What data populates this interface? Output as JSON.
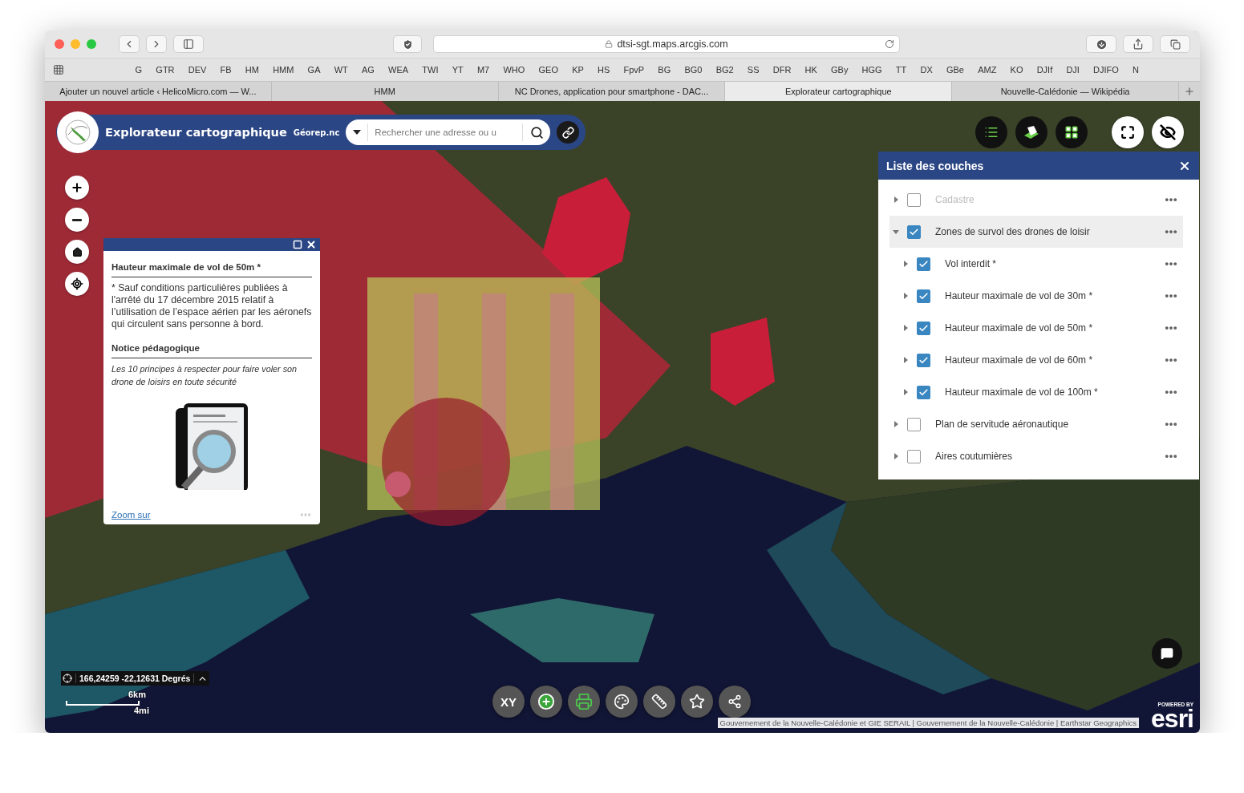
{
  "browser": {
    "url": "dtsi-sgt.maps.arcgis.com",
    "bookmarks": [
      "G",
      "GTR",
      "DEV",
      "FB",
      "HM",
      "HMM",
      "GA",
      "WT",
      "AG",
      "WEA",
      "TWI",
      "YT",
      "M7",
      "WHO",
      "GEO",
      "KP",
      "HS",
      "FpvP",
      "BG",
      "BG0",
      "BG2",
      "SS",
      "DFR",
      "HK",
      "GBy",
      "HGG",
      "TT",
      "DX",
      "GBe",
      "AMZ",
      "KO",
      "DJIf",
      "DJI",
      "DJIFO",
      "N"
    ],
    "tabs": [
      {
        "label": "Ajouter un nouvel article ‹ HelicoMicro.com — W...",
        "selected": false
      },
      {
        "label": "HMM",
        "selected": false
      },
      {
        "label": "NC Drones, application pour smartphone - DAC...",
        "selected": false
      },
      {
        "label": "Explorateur cartographique",
        "selected": true
      },
      {
        "label": "Nouvelle-Calédonie — Wikipédia",
        "selected": false
      }
    ]
  },
  "app": {
    "title": "Explorateur cartographique",
    "subtitle": "Géorep.nc",
    "search": {
      "placeholder": "Rechercher une adresse ou u"
    }
  },
  "popup": {
    "title": "Hauteur maximale de vol de 50m *",
    "footnote": "* Sauf conditions particulières publiées à l'arrêté du 17 décembre 2015 relatif à l’utilisation de l’espace aérien par les aéronefs qui circulent sans personne à bord.",
    "notice_heading": "Notice pédagogique",
    "notice_text": "Les 10 principes à respecter pour faire voler son drone de loisirs en toute sécurité",
    "link": "Zoom sur"
  },
  "layer_panel": {
    "title": "Liste des couches",
    "layers": [
      {
        "label": "Cadastre",
        "checked": false,
        "expanded": false,
        "disabled": true,
        "selected": false
      },
      {
        "label": "Zones de survol des drones de loisir",
        "checked": true,
        "expanded": true,
        "disabled": false,
        "selected": true,
        "children": [
          {
            "label": "Vol interdit *",
            "checked": true,
            "expanded": false,
            "disabled": false,
            "selected": false
          },
          {
            "label": "Hauteur maximale de vol de 30m *",
            "checked": true,
            "expanded": false,
            "disabled": false,
            "selected": false
          },
          {
            "label": "Hauteur maximale de vol de 50m *",
            "checked": true,
            "expanded": false,
            "disabled": false,
            "selected": false
          },
          {
            "label": "Hauteur maximale de vol de 60m *",
            "checked": true,
            "expanded": false,
            "disabled": false,
            "selected": false
          },
          {
            "label": "Hauteur maximale de vol de 100m *",
            "checked": true,
            "expanded": false,
            "disabled": false,
            "selected": false
          }
        ]
      },
      {
        "label": "Plan de servitude aéronautique",
        "checked": false,
        "expanded": false,
        "disabled": false,
        "selected": false
      },
      {
        "label": "Aires coutumières",
        "checked": false,
        "expanded": false,
        "disabled": false,
        "selected": false
      }
    ]
  },
  "coordinates": "166,24259 -22,12631 Degrés",
  "scale": {
    "metric": "6km",
    "imperial": "4mi"
  },
  "toolbar": [
    {
      "kind": "xy",
      "label": "XY"
    },
    {
      "kind": "add"
    },
    {
      "kind": "print"
    },
    {
      "kind": "palette"
    },
    {
      "kind": "ruler"
    },
    {
      "kind": "star"
    },
    {
      "kind": "share"
    }
  ],
  "attribution": "Gouvernement de la Nouvelle-Calédonie et GIE SERAIL | Gouvernement de la Nouvelle-Calédonie | Earthstar Geographics",
  "esri": {
    "tagline": "POWERED BY",
    "logo": "esri"
  }
}
